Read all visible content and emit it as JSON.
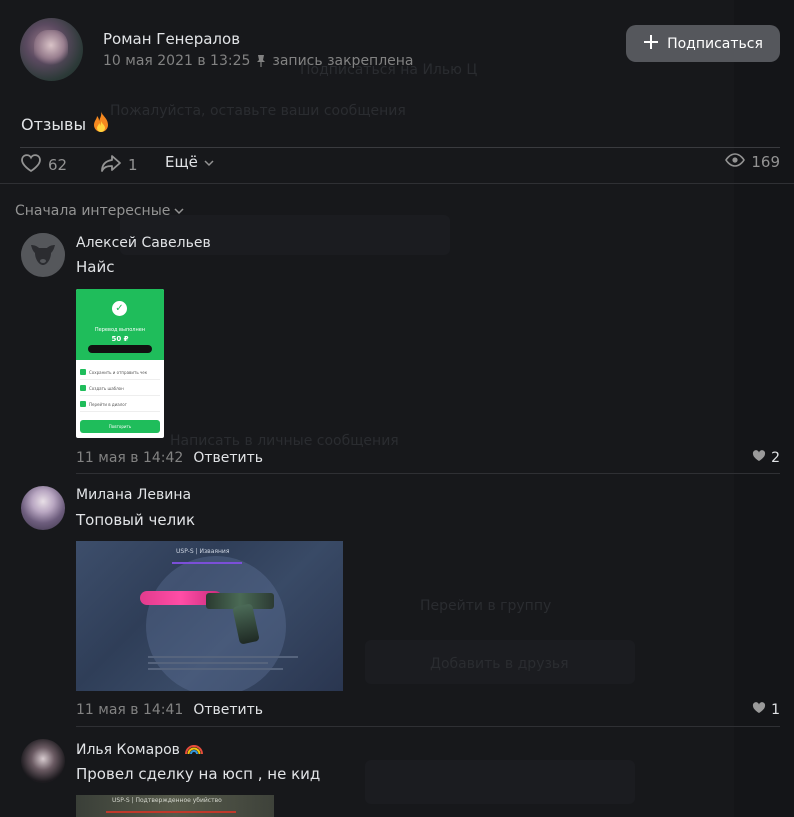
{
  "post": {
    "author": "Роман Генералов",
    "date": "10 мая 2021 в 13:25",
    "pinned_label": "запись закреплена",
    "subscribe_label": "Подписаться",
    "text": "Отзывы",
    "likes": "62",
    "shares": "1",
    "more_label": "Ещё",
    "views": "169"
  },
  "comments_sort": "Сначала интересные",
  "comments": [
    {
      "name": "Алексей Савельев",
      "text": "Найс",
      "time": "11 мая в 14:42",
      "reply_label": "Ответить",
      "likes": "2"
    },
    {
      "name": "Милана Левина",
      "text": "Топовый челик",
      "time": "11 мая в 14:41",
      "reply_label": "Ответить",
      "likes": "1"
    },
    {
      "name": "Илья Комаров",
      "text": "Провел сделку на юсп , не кид"
    }
  ],
  "attachment1": {
    "title": "Перевод выполнен",
    "amount": "50 ₽",
    "rows": [
      "Сохранить и отправить чек",
      "Создать шаблон",
      "Перейти в диалог"
    ],
    "button": "Повторить"
  },
  "attachment2": {
    "header": "USP-S | Изваяния"
  },
  "attachment3": {
    "header": "USP-S | Подтвержденное убийство"
  },
  "background_ghost": {
    "line1": "Подписаться на Илью Ц",
    "line2": "Пожалуйста, оставьте ваши сообщения",
    "line3": "Написать в личные сообщения",
    "line4": "Перейти в группу",
    "line5": "Добавить в друзья"
  },
  "colors": {
    "background": "#17181b",
    "text": "#e1e3e6",
    "muted": "#828282",
    "button": "#55575c"
  }
}
